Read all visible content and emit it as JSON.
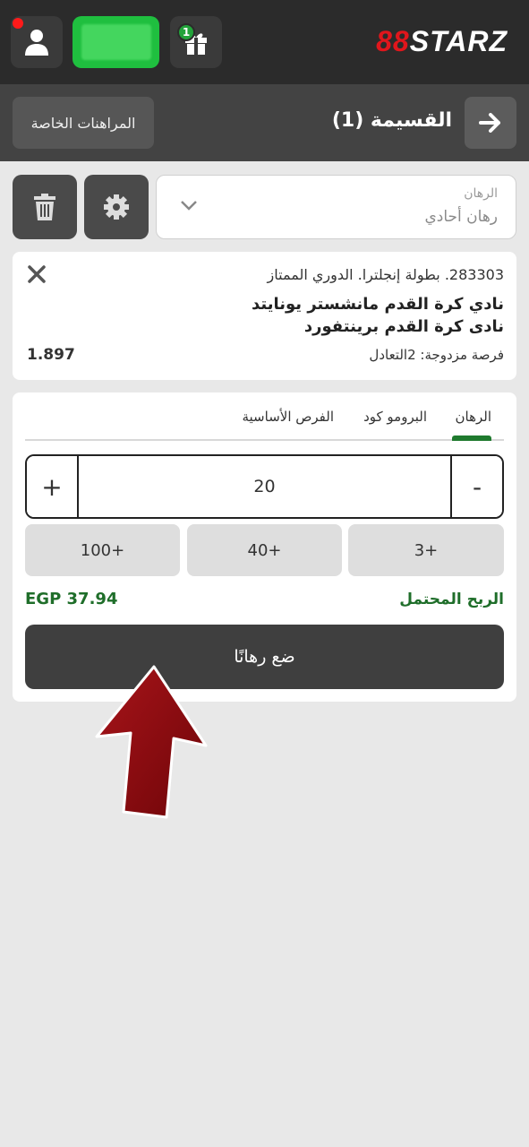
{
  "topbar": {
    "user_icon": "user-icon",
    "gift_icon": "gift-icon",
    "gift_badge": "1",
    "logo_part1": "88",
    "logo_part2": "STARZ"
  },
  "header": {
    "special_bets_label": "المراهنات الخاصة",
    "coupon_title": "القسيمة (1)",
    "arrow_icon": "arrow-right-icon"
  },
  "bet_type": {
    "label": "الرهان",
    "value": "رهان أحادي"
  },
  "event": {
    "league": "283303. بطولة إنجلترا. الدوري الممتاز",
    "team1": "نادي كرة القدم مانشستر يونايتد",
    "team2": "نادى كرة القدم برينتفورد",
    "market": "فرصة مزدوجة: 2التعادل",
    "odds": "1.897"
  },
  "stake": {
    "tabs": [
      "الرهان",
      "البرومو كود",
      "الفرص الأساسية"
    ],
    "active_tab": 0,
    "amount": "20",
    "plus": "+",
    "minus": "-",
    "quick_amounts": [
      "100+",
      "40+",
      "3+"
    ],
    "profit_label": "الربح المحتمل",
    "profit_value": "EGP 37.94",
    "place_bet_label": "ضع رهانًا"
  },
  "colors": {
    "accent_green": "#1f7a2e",
    "balance_green": "#1fbf3f",
    "arrow_red": "#8b0a0a"
  }
}
